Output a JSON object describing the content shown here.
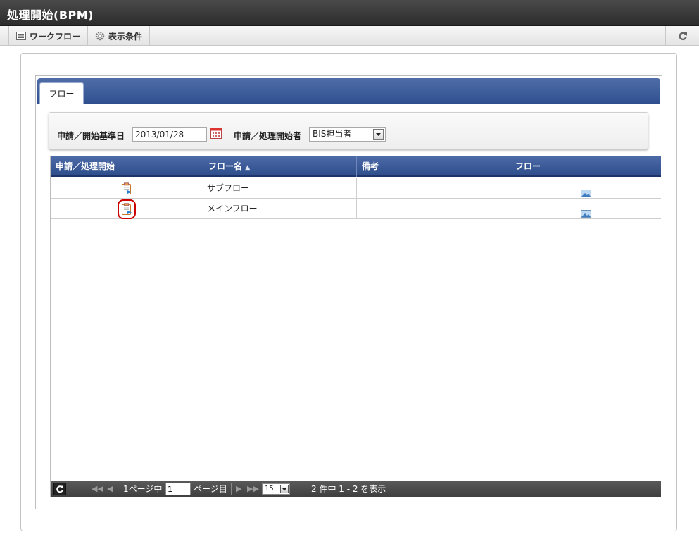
{
  "window": {
    "title": "処理開始(BPM)"
  },
  "toolbar": {
    "workflow_label": "ワークフロー",
    "display_conditions_label": "表示条件"
  },
  "tabs": [
    {
      "label": "フロー"
    }
  ],
  "search": {
    "date_label": "申請／開始基準日",
    "date_value": "2013/01/28",
    "starter_label": "申請／処理開始者",
    "starter_value": "BIS担当者"
  },
  "grid": {
    "headers": [
      "申請／処理開始",
      "フロー名",
      "備考",
      "フロー"
    ],
    "sort_indicator": "▲",
    "rows": [
      {
        "flow_name": "サブフロー",
        "note": ""
      },
      {
        "flow_name": "メインフロー",
        "note": ""
      }
    ]
  },
  "pager": {
    "page_prefix": "1ページ中",
    "page_value": "1",
    "page_suffix": "ページ目",
    "page_size": "15",
    "summary": "2 件中 1 - 2 を表示"
  },
  "colors": {
    "header_blue": "#2e4d8c",
    "highlight_red": "#cc0000"
  }
}
